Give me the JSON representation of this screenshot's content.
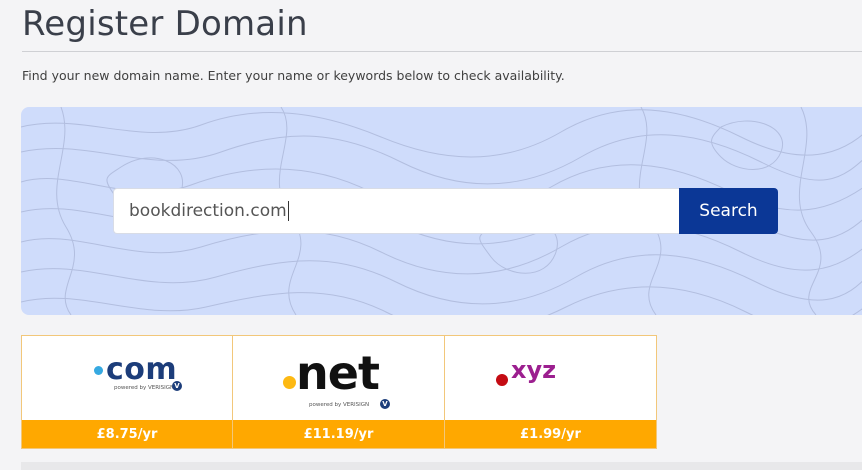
{
  "page": {
    "title": "Register Domain",
    "intro": "Find your new domain name. Enter your name or keywords below to check availability."
  },
  "search": {
    "value": "bookdirection.com",
    "button_label": "Search"
  },
  "tlds": [
    {
      "name": ".com",
      "logo_text": "com",
      "powered_by": "powered by VERISIGN",
      "price": "£8.75/yr",
      "dot_color": "#36a9e1"
    },
    {
      "name": ".net",
      "logo_text": "net",
      "powered_by": "powered by VERISIGN",
      "price": "£11.19/yr",
      "dot_color": "#fdb913"
    },
    {
      "name": ".xyz",
      "logo_text": "xyz",
      "price": "£1.99/yr",
      "dot_color": "#c40b13"
    }
  ],
  "colors": {
    "accent": "#0b3796",
    "price_bar": "#ffa800",
    "hero_bg": "#cfdcfb",
    "card_border": "#f2c77a"
  }
}
